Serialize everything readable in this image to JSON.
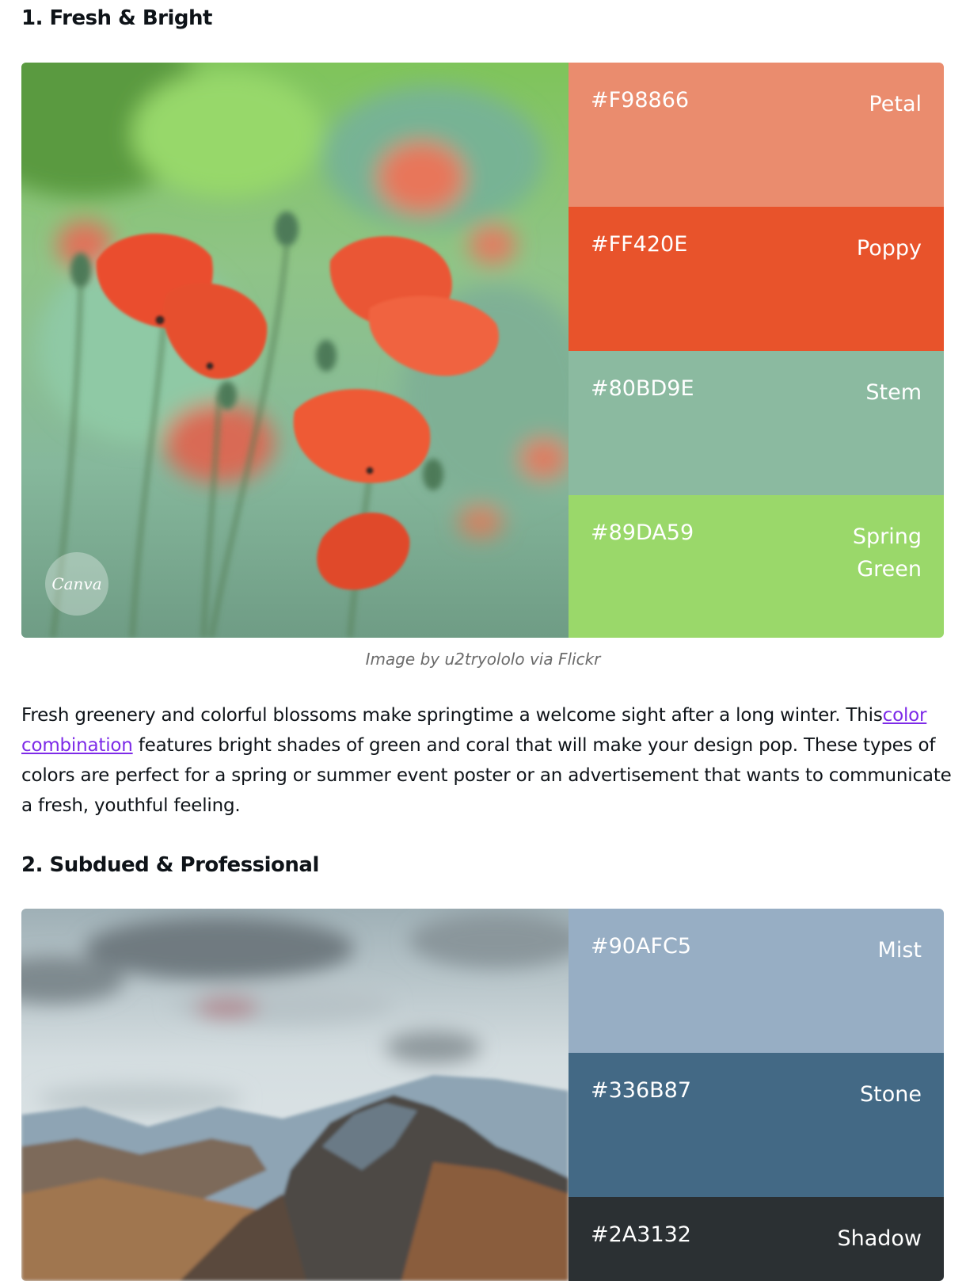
{
  "sections": [
    {
      "heading": "1. Fresh & Bright",
      "palette": [
        {
          "hex": "#F98866",
          "name": "Petal",
          "color": "#EA8C6E"
        },
        {
          "hex": "#FF420E",
          "name": "Poppy",
          "color": "#E8532B"
        },
        {
          "hex": "#80BD9E",
          "name": "Stem",
          "color": "#8BBAA0"
        },
        {
          "hex": "#89DA59",
          "name": "Spring Green",
          "color": "#9AD86A"
        }
      ],
      "watermark": "Canva",
      "caption": "Image by u2tryololo via Flickr",
      "paragraph": {
        "before_link": "Fresh greenery and colorful blossoms make springtime a welcome sight after a long winter. This",
        "link": "color combination",
        "after_link": " features bright shades of green and coral that will make your design pop. These types of colors are perfect for a spring or summer event poster or an advertisement that wants to communicate a fresh, youthful feeling."
      }
    },
    {
      "heading": "2. Subdued & Professional",
      "palette": [
        {
          "hex": "#90AFC5",
          "name": "Mist",
          "color": "#97AEC4"
        },
        {
          "hex": "#336B87",
          "name": "Stone",
          "color": "#436985"
        },
        {
          "hex": "#2A3132",
          "name": "Shadow",
          "color": "#2B3033"
        }
      ]
    }
  ],
  "colors": {
    "link": "#7D2AE8",
    "text": "#0E1318",
    "caption": "#6B6B6B"
  }
}
